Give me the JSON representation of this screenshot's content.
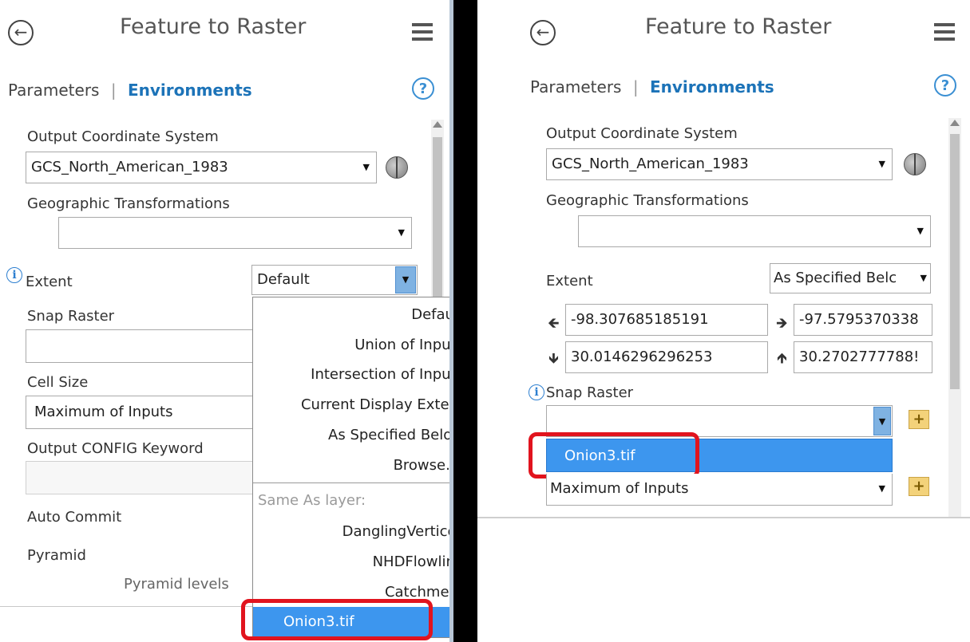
{
  "left": {
    "title": "Feature to Raster",
    "tabs": {
      "parameters": "Parameters",
      "separator": "|",
      "environments": "Environments"
    },
    "help": "?",
    "output_cs": {
      "label": "Output Coordinate System",
      "value": "GCS_North_American_1983"
    },
    "geo_trans": {
      "label": "Geographic Transformations",
      "value": ""
    },
    "extent": {
      "label": "Extent",
      "value": "Default"
    },
    "snap_raster": {
      "label": "Snap Raster",
      "value": ""
    },
    "cell_size": {
      "label": "Cell Size",
      "value": "Maximum of Inputs"
    },
    "config": {
      "label": "Output CONFIG Keyword",
      "value": ""
    },
    "auto_commit": {
      "label": "Auto Commit"
    },
    "pyramid": {
      "label": "Pyramid",
      "levels_label": "Pyramid levels"
    },
    "extent_menu": {
      "items": [
        "Default",
        "Union of Inputs",
        "Intersection of Inputs",
        "Current Display Extent",
        "As Specified Below",
        "Browse...."
      ],
      "group_label": "Same As layer:",
      "layers": [
        "DanglingVertices",
        "NHDFlowline",
        "Catchment",
        "Onion3.tif"
      ],
      "selected": "Onion3.tif"
    }
  },
  "right": {
    "title": "Feature to Raster",
    "tabs": {
      "parameters": "Parameters",
      "separator": "|",
      "environments": "Environments"
    },
    "help": "?",
    "output_cs": {
      "label": "Output Coordinate System",
      "value": "GCS_North_American_1983"
    },
    "geo_trans": {
      "label": "Geographic Transformations",
      "value": ""
    },
    "extent": {
      "label": "Extent",
      "value": "As Specified Belc",
      "left": "-98.307685185191",
      "right": "-97.5795370338",
      "bottom": "30.0146296296253",
      "top": "30.2702777788!"
    },
    "snap_raster": {
      "label": "Snap Raster",
      "value": "",
      "option": "Onion3.tif"
    },
    "cell_size": {
      "value": "Maximum of Inputs"
    }
  },
  "colors": {
    "accent": "#1c73b8",
    "highlight": "#3d96ee",
    "annotation": "#e1141e"
  }
}
